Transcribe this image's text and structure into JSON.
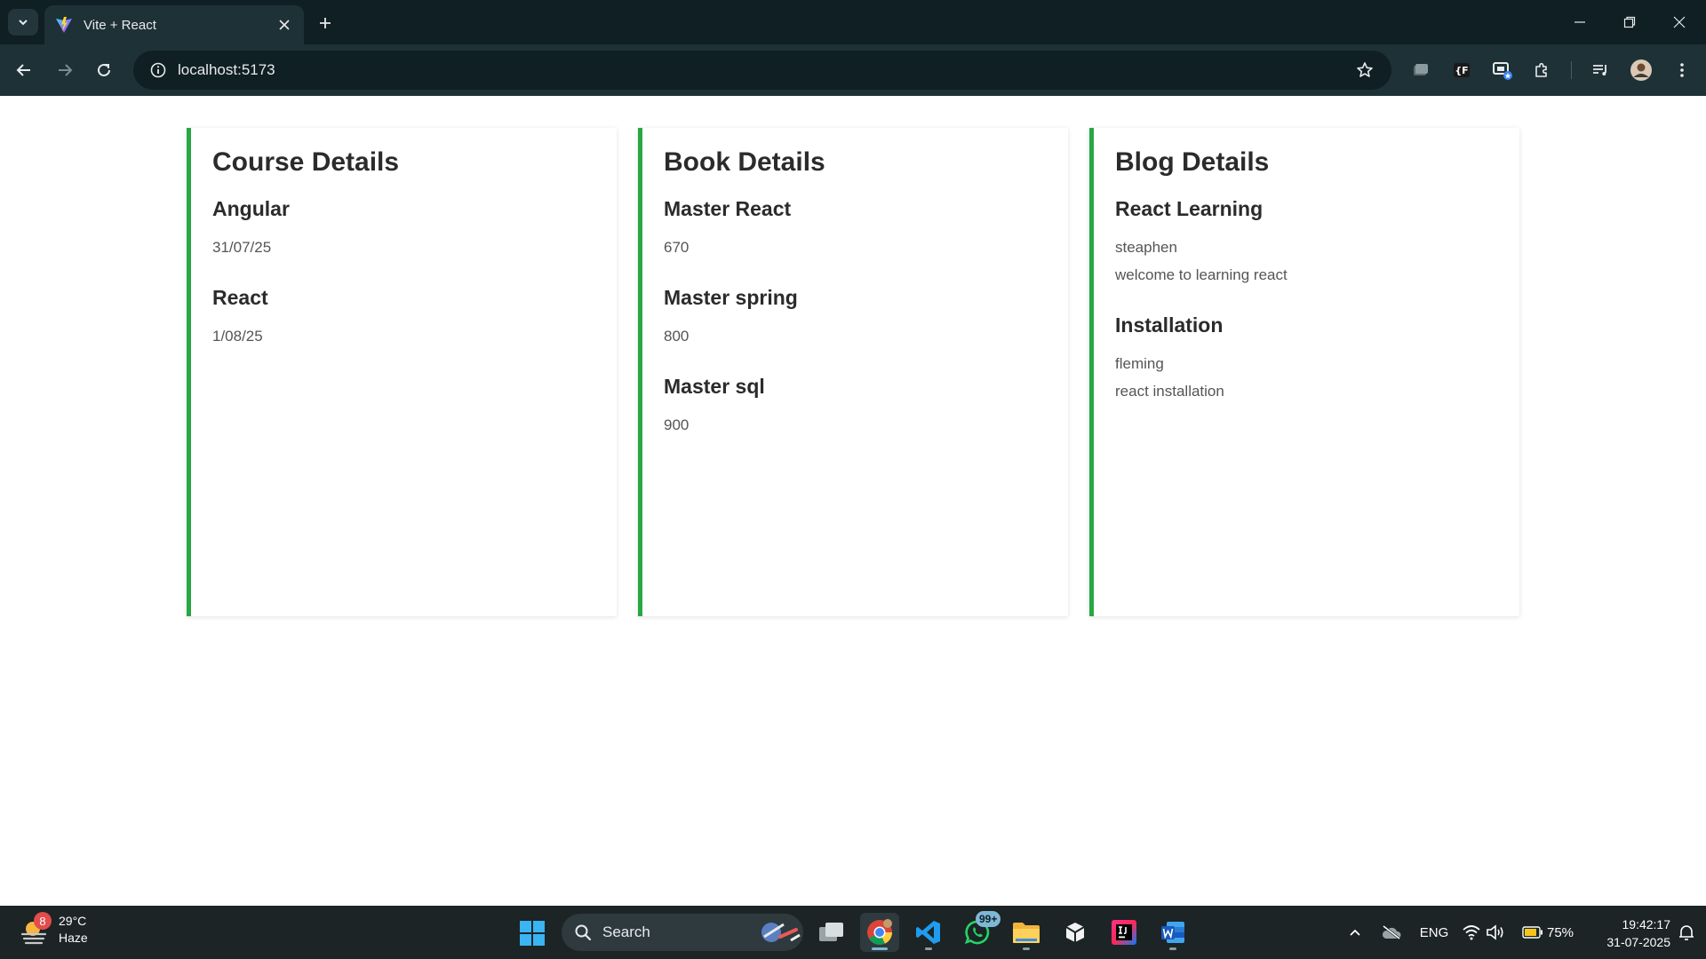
{
  "browser": {
    "tab_title": "Vite + React",
    "url": "localhost:5173"
  },
  "cards": {
    "course": {
      "title": "Course Details",
      "items": [
        {
          "name": "Angular",
          "date": "31/07/25"
        },
        {
          "name": "React",
          "date": "1/08/25"
        }
      ]
    },
    "book": {
      "title": "Book Details",
      "items": [
        {
          "name": "Master React",
          "price": "670"
        },
        {
          "name": "Master spring",
          "price": "800"
        },
        {
          "name": "Master sql",
          "price": "900"
        }
      ]
    },
    "blog": {
      "title": "Blog Details",
      "items": [
        {
          "name": "React Learning",
          "author": "steaphen",
          "content": "welcome to learning react"
        },
        {
          "name": "Installation",
          "author": "fleming",
          "content": "react installation"
        }
      ]
    }
  },
  "colors": {
    "accent": "#28a745",
    "chrome_dark": "#0f1f24",
    "chrome_toolbar": "#1e3137",
    "taskbar": "#1c2426"
  },
  "taskbar": {
    "weather_badge": "8",
    "temperature": "29°C",
    "condition": "Haze",
    "search_label": "Search",
    "whatsapp_badge": "99+",
    "language": "ENG",
    "battery": "75%",
    "time": "19:42:17",
    "date": "31-07-2025"
  },
  "icons": {
    "tab_search": "chevron-down-icon",
    "favicon": "vite-logo-icon",
    "close": "close-icon",
    "new_tab": "plus-icon",
    "back": "arrow-left-icon",
    "forward": "arrow-right-icon",
    "reload": "reload-icon",
    "site_info": "info-icon",
    "bookmark": "star-icon",
    "extensions": "puzzle-icon",
    "menu": "kebab-icon"
  }
}
